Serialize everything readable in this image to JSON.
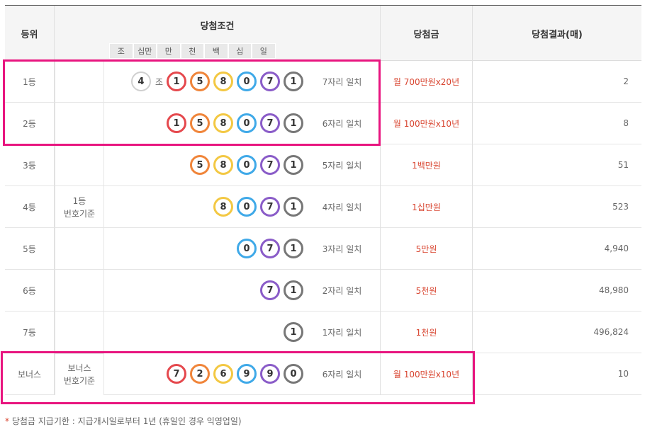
{
  "header": {
    "rank": "등위",
    "condition": "당첨조건",
    "prize": "당첨금",
    "result": "당첨결과(매)",
    "digits": [
      "조",
      "십만",
      "만",
      "천",
      "백",
      "십",
      "일"
    ]
  },
  "basis": {
    "first": "1등\n번호기준",
    "bonus": "보너스\n번호기준"
  },
  "ball_colors": {
    "1": "#e5484d",
    "5": "#f0853a",
    "8": "#f3c843",
    "0": "#3fa9e8",
    "7": "#8a5cc8",
    "1b": "#777777",
    "2": "#f0853a",
    "6": "#f3c843",
    "9": "#3fa9e8",
    "0b": "#777777"
  },
  "rows": [
    {
      "rank": "1등",
      "jo": "4",
      "jo_label": "조",
      "balls": [
        {
          "n": "1",
          "c": "#e5484d"
        },
        {
          "n": "5",
          "c": "#f0853a"
        },
        {
          "n": "8",
          "c": "#f3c843"
        },
        {
          "n": "0",
          "c": "#3fa9e8"
        },
        {
          "n": "7",
          "c": "#8a5cc8"
        },
        {
          "n": "1",
          "c": "#777777"
        }
      ],
      "match": "7자리 일치",
      "prize": "월 700만원x20년",
      "result": "2"
    },
    {
      "rank": "2등",
      "balls": [
        {
          "n": "1",
          "c": "#e5484d"
        },
        {
          "n": "5",
          "c": "#f0853a"
        },
        {
          "n": "8",
          "c": "#f3c843"
        },
        {
          "n": "0",
          "c": "#3fa9e8"
        },
        {
          "n": "7",
          "c": "#8a5cc8"
        },
        {
          "n": "1",
          "c": "#777777"
        }
      ],
      "match": "6자리 일치",
      "prize": "월 100만원x10년",
      "result": "8"
    },
    {
      "rank": "3등",
      "balls": [
        {
          "n": "5",
          "c": "#f0853a"
        },
        {
          "n": "8",
          "c": "#f3c843"
        },
        {
          "n": "0",
          "c": "#3fa9e8"
        },
        {
          "n": "7",
          "c": "#8a5cc8"
        },
        {
          "n": "1",
          "c": "#777777"
        }
      ],
      "match": "5자리 일치",
      "prize": "1백만원",
      "result": "51"
    },
    {
      "rank": "4등",
      "balls": [
        {
          "n": "8",
          "c": "#f3c843"
        },
        {
          "n": "0",
          "c": "#3fa9e8"
        },
        {
          "n": "7",
          "c": "#8a5cc8"
        },
        {
          "n": "1",
          "c": "#777777"
        }
      ],
      "match": "4자리 일치",
      "prize": "1십만원",
      "result": "523"
    },
    {
      "rank": "5등",
      "balls": [
        {
          "n": "0",
          "c": "#3fa9e8"
        },
        {
          "n": "7",
          "c": "#8a5cc8"
        },
        {
          "n": "1",
          "c": "#777777"
        }
      ],
      "match": "3자리 일치",
      "prize": "5만원",
      "result": "4,940"
    },
    {
      "rank": "6등",
      "balls": [
        {
          "n": "7",
          "c": "#8a5cc8"
        },
        {
          "n": "1",
          "c": "#777777"
        }
      ],
      "match": "2자리 일치",
      "prize": "5천원",
      "result": "48,980"
    },
    {
      "rank": "7등",
      "balls": [
        {
          "n": "1",
          "c": "#777777"
        }
      ],
      "match": "1자리 일치",
      "prize": "1천원",
      "result": "496,824"
    },
    {
      "rank": "보너스",
      "balls": [
        {
          "n": "7",
          "c": "#e5484d"
        },
        {
          "n": "2",
          "c": "#f0853a"
        },
        {
          "n": "6",
          "c": "#f3c843"
        },
        {
          "n": "9",
          "c": "#3fa9e8"
        },
        {
          "n": "9",
          "c": "#8a5cc8"
        },
        {
          "n": "0",
          "c": "#777777"
        }
      ],
      "match": "6자리 일치",
      "prize": "월 100만원x10년",
      "result": "10"
    }
  ],
  "highlight_color": "#e8157f",
  "footnote": {
    "star": "*",
    "text": " 당첨금 지급기한 : 지급개시일로부터 1년 (휴일인 경우 익영업일)"
  }
}
